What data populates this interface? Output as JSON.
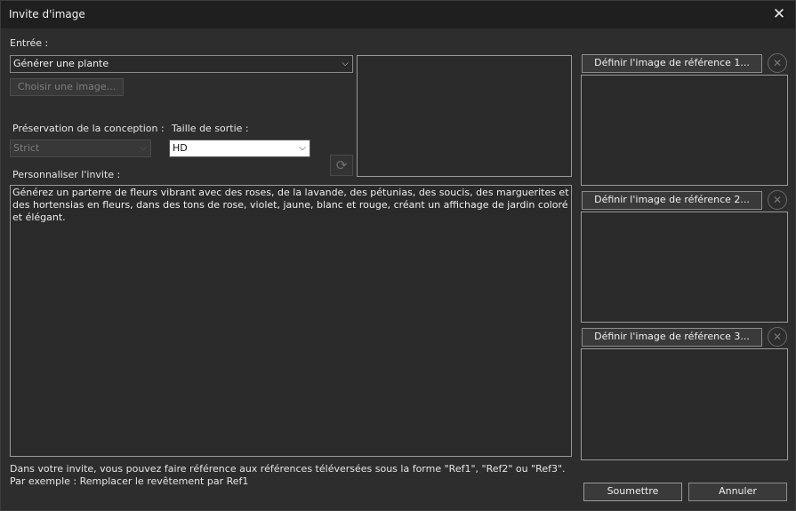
{
  "window": {
    "title": "Invite d'image",
    "close_glyph": "✕"
  },
  "input": {
    "label": "Entrée :",
    "selected": "Générer une plante",
    "choose_image_label": "Choisir une image..."
  },
  "design_preservation": {
    "label": "Préservation de la conception :",
    "selected": "Strict"
  },
  "output_size": {
    "label": "Taille de sortie :",
    "selected": "HD"
  },
  "prompt": {
    "label": "Personnaliser l'invite :",
    "text": "Générez un parterre de fleurs vibrant avec des roses, de la lavande, des pétunias, des soucis, des marguerites et des hortensias en fleurs, dans des tons de rose, violet, jaune, blanc et rouge, créant un affichage de jardin coloré et élégant."
  },
  "references": [
    {
      "button_label": "Définir l'image de référence 1..."
    },
    {
      "button_label": "Définir l'image de référence 2..."
    },
    {
      "button_label": "Définir l'image de référence 3..."
    }
  ],
  "hints": {
    "line1": "Dans votre invite, vous pouvez faire référence aux références téléversées sous la forme \"Ref1\", \"Ref2\" ou \"Ref3\".",
    "line2": "Par exemple : Remplacer le revêtement par Ref1"
  },
  "actions": {
    "submit_label": "Soumettre",
    "cancel_label": "Annuler"
  },
  "icons": {
    "chevron": "⌵",
    "refresh": "⟳",
    "clear": "✕"
  }
}
